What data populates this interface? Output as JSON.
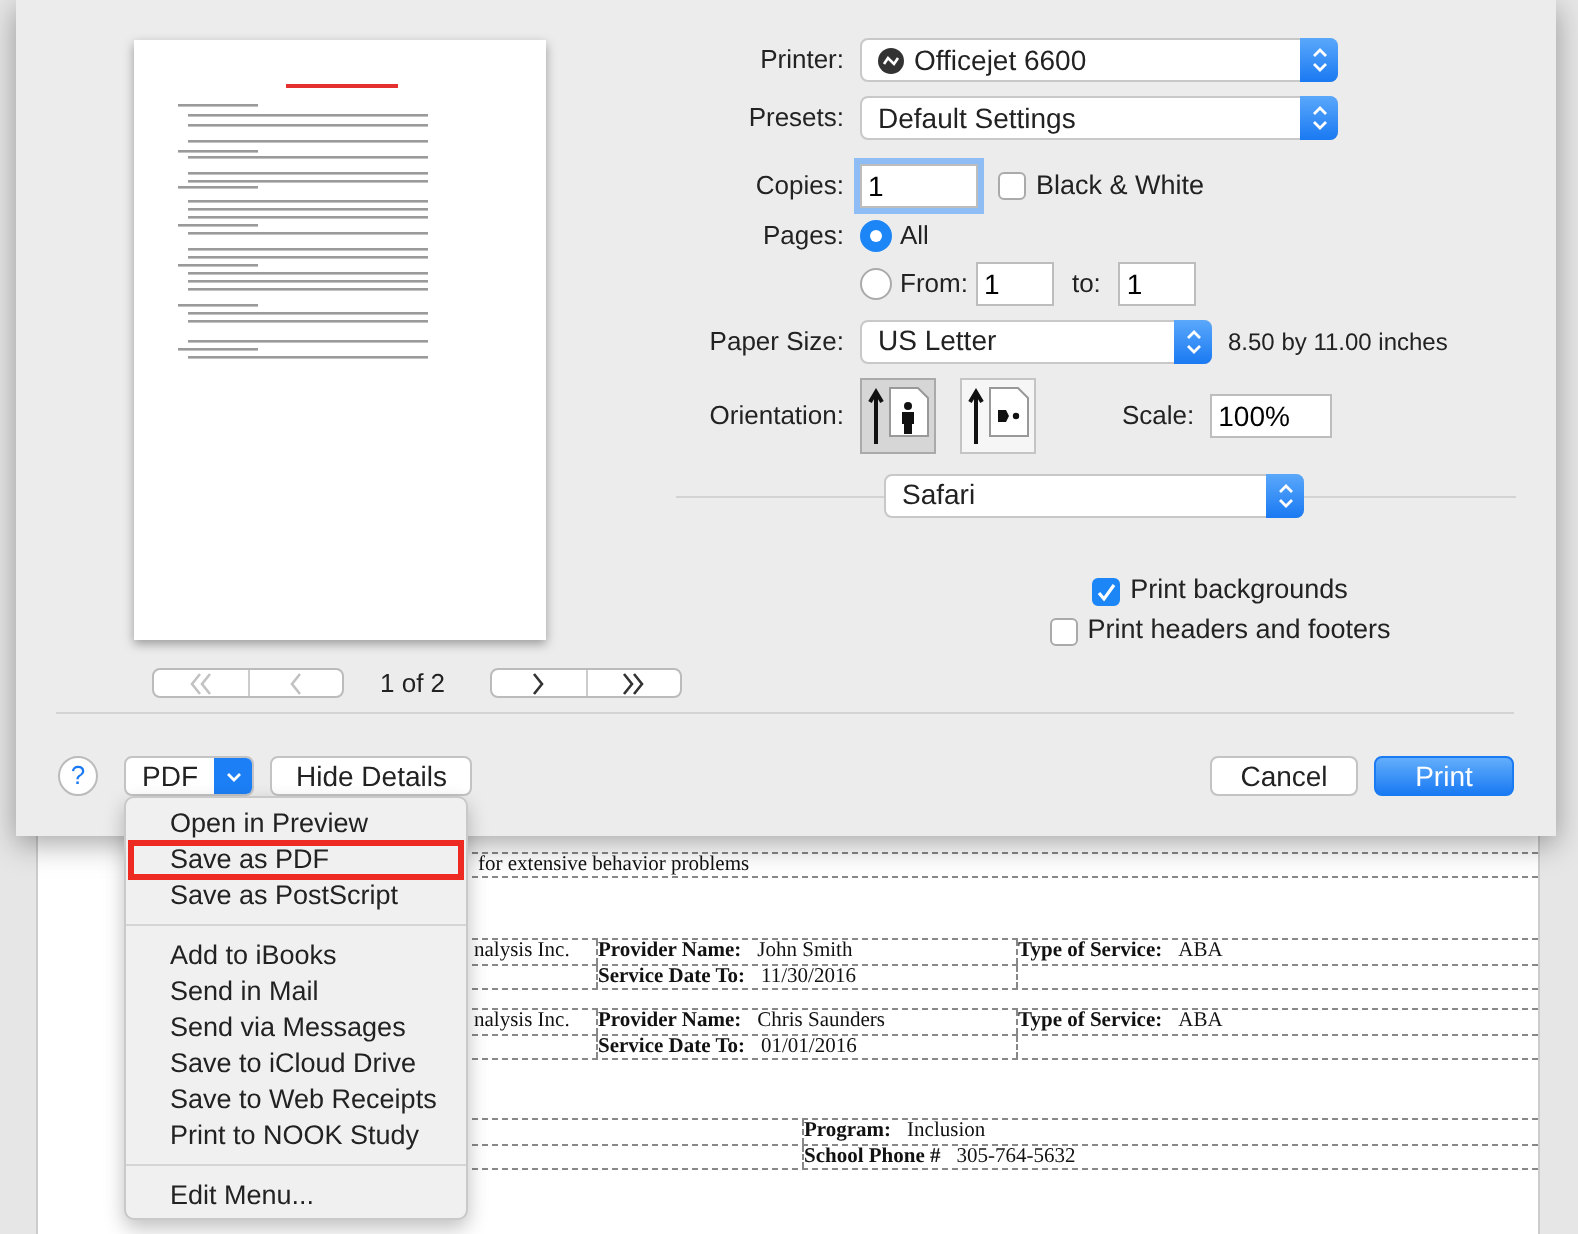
{
  "preview": {
    "page_indicator": "1 of 2",
    "nav": [
      {
        "kind": "first",
        "disabled": true
      },
      {
        "kind": "prev",
        "disabled": true
      },
      {
        "kind": "next",
        "disabled": false
      },
      {
        "kind": "last",
        "disabled": false
      }
    ]
  },
  "printer": {
    "label": "Printer:",
    "value": "Officejet 6600"
  },
  "presets": {
    "label": "Presets:",
    "value": "Default Settings"
  },
  "copies": {
    "label": "Copies:",
    "value": "1"
  },
  "black_white": {
    "label": "Black & White",
    "checked": false
  },
  "pages": {
    "label": "Pages:",
    "options": [
      {
        "label": "All",
        "selected": true
      },
      {
        "label": "From:",
        "selected": false
      }
    ],
    "from": "1",
    "to_label": "to:",
    "to": "1"
  },
  "paper_size": {
    "label": "Paper Size:",
    "value": "US Letter",
    "dimensions": "8.50 by 11.00 inches"
  },
  "orientation": {
    "label": "Orientation:",
    "options": [
      {
        "kind": "portrait",
        "selected": true
      },
      {
        "kind": "landscape",
        "selected": false
      }
    ]
  },
  "scale": {
    "label": "Scale:",
    "value": "100%"
  },
  "section": {
    "value": "Safari"
  },
  "options": [
    {
      "label": "Print backgrounds",
      "checked": true
    },
    {
      "label": "Print headers and footers",
      "checked": false
    }
  ],
  "footer": {
    "help": "?",
    "pdf": "PDF",
    "hide_details": "Hide Details",
    "cancel": "Cancel",
    "print": "Print"
  },
  "pdf_menu": [
    [
      {
        "label": "Open in Preview",
        "outlined": false
      },
      {
        "label": "Save as PDF",
        "outlined": true
      },
      {
        "label": "Save as PostScript",
        "outlined": false
      }
    ],
    [
      {
        "label": "Add to iBooks",
        "outlined": false
      },
      {
        "label": "Send in Mail",
        "outlined": false
      },
      {
        "label": "Send via Messages",
        "outlined": false
      },
      {
        "label": "Save to iCloud Drive",
        "outlined": false
      },
      {
        "label": "Save to Web Receipts",
        "outlined": false
      },
      {
        "label": "Print to NOOK Study",
        "outlined": false
      }
    ],
    [
      {
        "label": "Edit Menu...",
        "outlined": false
      }
    ]
  ],
  "document": {
    "explain_tail": "for extensive behavior problems",
    "treatments": [
      {
        "agency_tail": "nalysis Inc.",
        "provider_label": "Provider Name:",
        "provider": "John Smith",
        "type_label": "Type of Service:",
        "type": "ABA",
        "date_label": "Service Date To:",
        "date": "11/30/2016"
      },
      {
        "agency_tail": "nalysis Inc.",
        "provider_label": "Provider Name:",
        "provider": "Chris Saunders",
        "type_label": "Type of Service:",
        "type": "ABA",
        "date_label": "Service Date To:",
        "date": "01/01/2016"
      }
    ],
    "program_label": "Program:",
    "program": "Inclusion",
    "phone_label": "School Phone #",
    "phone": "305-764-5632"
  }
}
